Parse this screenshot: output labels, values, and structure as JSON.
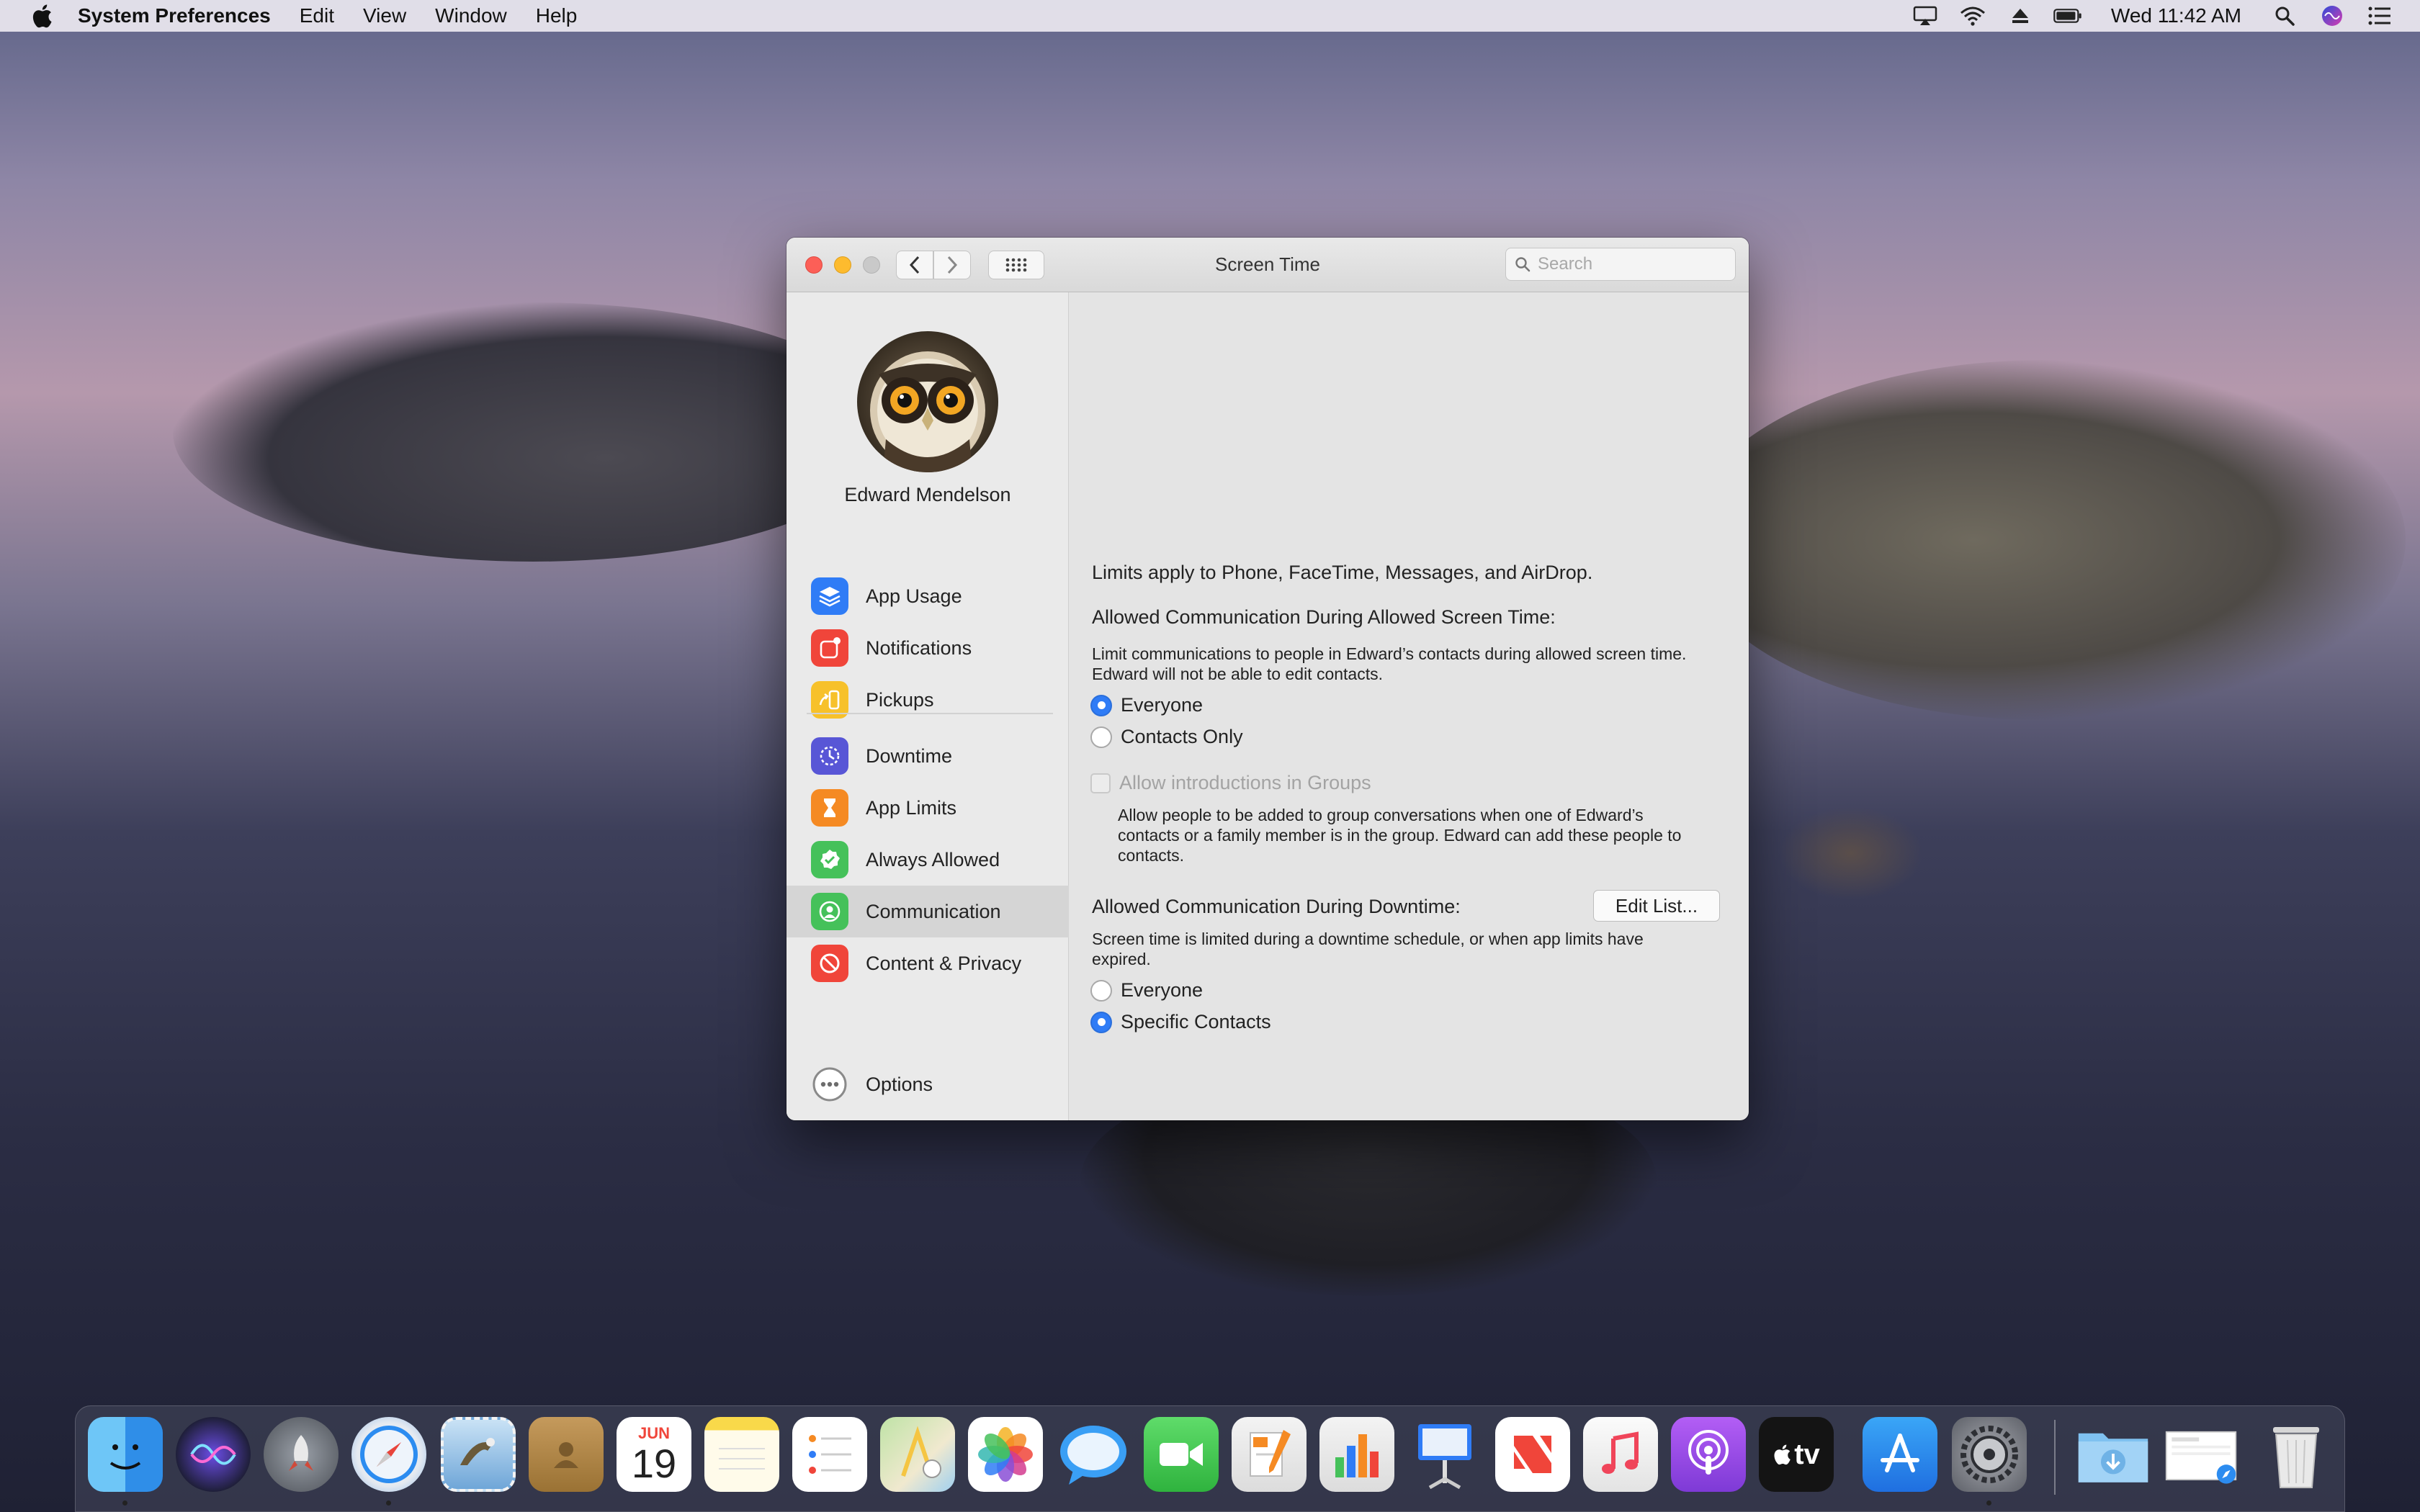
{
  "menubar": {
    "app_name": "System Preferences",
    "menus": [
      "Edit",
      "View",
      "Window",
      "Help"
    ],
    "clock": "Wed 11:42 AM"
  },
  "window": {
    "title": "Screen Time",
    "search_placeholder": "Search"
  },
  "sidebar": {
    "user_name": "Edward Mendelson",
    "items": [
      {
        "label": "App Usage",
        "icon": "layers-icon",
        "color": "#2f7cf6"
      },
      {
        "label": "Notifications",
        "icon": "notification-icon",
        "color": "#f0453a"
      },
      {
        "label": "Pickups",
        "icon": "pickup-icon",
        "color": "#f7c12a"
      },
      {
        "label": "Downtime",
        "icon": "downtime-icon",
        "color": "#5856d6"
      },
      {
        "label": "App Limits",
        "icon": "hourglass-icon",
        "color": "#f58a23"
      },
      {
        "label": "Always Allowed",
        "icon": "checkmark-badge-icon",
        "color": "#45c15a"
      },
      {
        "label": "Communication",
        "icon": "contact-icon",
        "color": "#45c15a"
      },
      {
        "label": "Content & Privacy",
        "icon": "prohibited-icon",
        "color": "#f0453a"
      }
    ],
    "options_label": "Options"
  },
  "content": {
    "intro": "Limits apply to Phone, FaceTime, Messages, and AirDrop.",
    "section1_title": "Allowed Communication During Allowed Screen Time:",
    "section1_desc_line1": "Limit communications to people in Edward’s contacts during allowed screen time.",
    "section1_desc_line2": "Edward will not be able to edit contacts.",
    "radio_everyone": "Everyone",
    "radio_contacts_only": "Contacts Only",
    "checkbox_groups": "Allow introductions in Groups",
    "groups_desc_line1": "Allow people to be added to group conversations when one of Edward’s",
    "groups_desc_line2": "contacts or a family member is in the group. Edward can add these people to",
    "groups_desc_line3": "contacts.",
    "section2_title": "Allowed Communication During Downtime:",
    "edit_list": "Edit List...",
    "section2_desc_line1": "Screen time is limited during a downtime schedule, or when app limits have",
    "section2_desc_line2": "expired.",
    "radio2_everyone": "Everyone",
    "radio2_specific": "Specific Contacts"
  },
  "dock": {
    "calendar_month": "JUN",
    "calendar_day": "19",
    "tv_label": "tv"
  }
}
